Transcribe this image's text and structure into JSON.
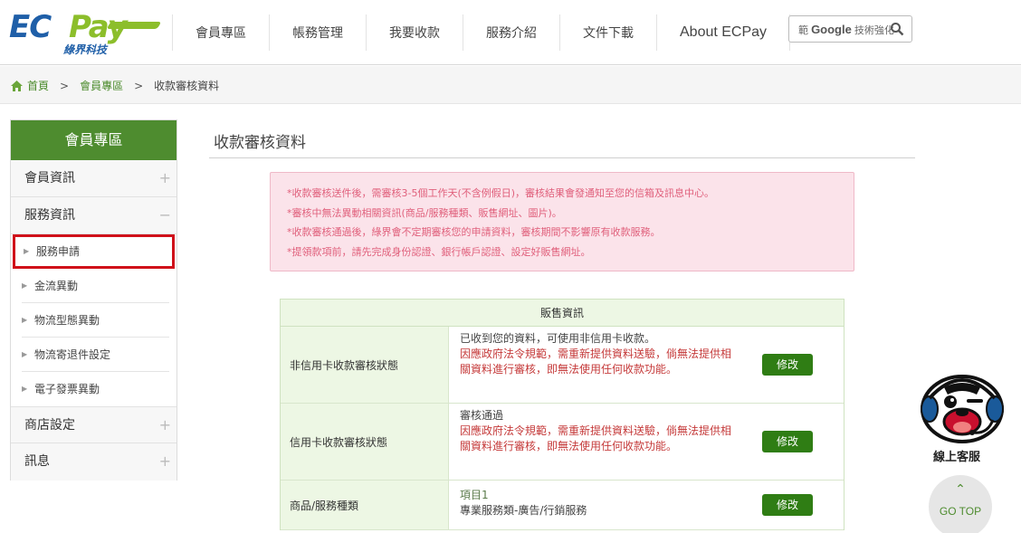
{
  "header": {
    "logo": {
      "ec": "EC",
      "pay": "Pay",
      "sub": "綠界科技"
    },
    "nav": [
      "會員專區",
      "帳務管理",
      "我要收款",
      "服務介紹",
      "文件下載",
      "About ECPay"
    ],
    "search": {
      "google": "Google",
      "enhanced": "技術強化",
      "prefix": "範"
    }
  },
  "breadcrumb": {
    "home": "首頁",
    "section": "會員專區",
    "current": "收款審核資料",
    "sep": ">"
  },
  "sidebar": {
    "title": "會員專區",
    "sections": [
      {
        "label": "會員資訊",
        "toggle": "+"
      },
      {
        "label": "服務資訊",
        "toggle": "−"
      }
    ],
    "sub_items": [
      "服務申請",
      "金流異動",
      "物流型態異動",
      "物流寄退件設定",
      "電子發票異動"
    ],
    "bottom_sections": [
      {
        "label": "商店設定",
        "toggle": "+"
      },
      {
        "label": "訊息",
        "toggle": "+"
      }
    ]
  },
  "main": {
    "title": "收款審核資料",
    "notices": [
      "*收款審核送件後，需審核3-5個工作天(不含例假日)，審核結果會發通知至您的信箱及訊息中心。",
      "*審核中無法異動相關資訊(商品/服務種類、販售網址、圖片)。",
      "*收款審核通過後，綠界會不定期審核您的申請資料，審核期間不影響原有收款服務。",
      "*提領款項前，請先完成身份認證、銀行帳戶認證、設定好販售網址。"
    ],
    "table": {
      "header": "販售資訊",
      "rows": [
        {
          "label": "非信用卡收款審核狀態",
          "status": "已收到您的資料，可使用非信用卡收款。",
          "warning": "因應政府法令規範，需重新提供資料送驗，倘無法提供相關資料進行審核，即無法使用任何收款功能。",
          "button": "修改"
        },
        {
          "label": "信用卡收款審核狀態",
          "status": "審核通過",
          "warning": "因應政府法令規範，需重新提供資料送驗，倘無法提供相關資料進行審核，即無法使用任何收款功能。",
          "button": "修改"
        },
        {
          "label": "商品/服務種類",
          "status": "項目1",
          "detail": "專業服務類-廣告/行銷服務",
          "button": "修改"
        }
      ]
    }
  },
  "customer_service": {
    "label": "線上客服"
  },
  "go_top": {
    "label": "GO TOP",
    "arrow": "⌃"
  },
  "colors": {
    "brand_green": "#4e8c2f",
    "button_green": "#2f7d14",
    "warning_red": "#c53a3a",
    "notice_pink": "#fbe3ea",
    "highlight_red": "#d0101a"
  }
}
